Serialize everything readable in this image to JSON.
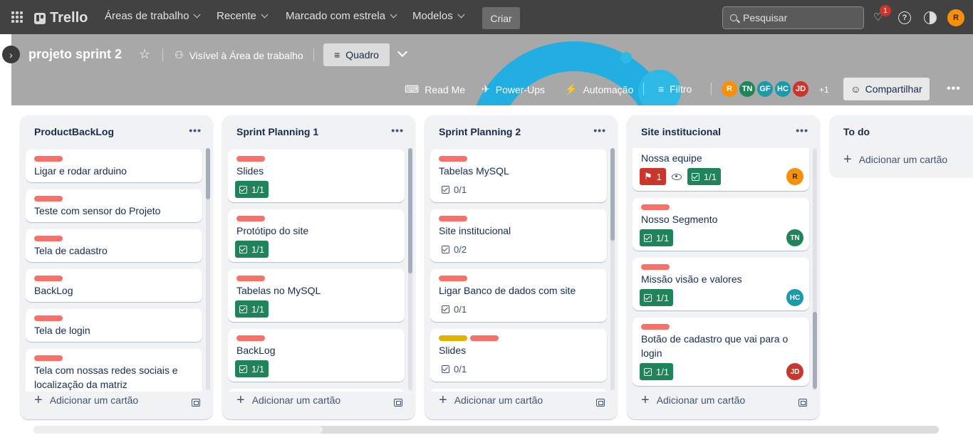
{
  "nav": {
    "brand": "Trello",
    "menus": [
      "Áreas de trabalho",
      "Recente",
      "Marcado com estrela",
      "Modelos"
    ],
    "create_label": "Criar",
    "search_placeholder": "Pesquisar",
    "notification_count": "1",
    "help_glyph": "?",
    "user_initial": "R"
  },
  "board": {
    "title": "projeto sprint 2",
    "visibility": "Visível à Área de trabalho",
    "view": "Quadro",
    "toolbar": [
      "Read Me",
      "Power-Ups",
      "Automação",
      "Filtro"
    ],
    "members": [
      {
        "initials": "R",
        "color": "#f79009"
      },
      {
        "initials": "TN",
        "color": "#1f845a"
      },
      {
        "initials": "GF",
        "color": "#1d9aaa"
      },
      {
        "initials": "HC",
        "color": "#1d9aaa"
      },
      {
        "initials": "JD",
        "color": "#c9372c"
      }
    ],
    "extra_members": "+1",
    "share": "Compartilhar"
  },
  "colors": {
    "label_red": "#f87168",
    "label_yellow": "#e2b203",
    "checklist_done": "#1f845a"
  },
  "lists": [
    {
      "title": "ProductBackLog",
      "add": "Adicionar um cartão",
      "cards": [
        {
          "title": "Ligar e rodar arduino"
        },
        {
          "title": "Teste com sensor do Projeto"
        },
        {
          "title": "Tela de cadastro"
        },
        {
          "title": "BackLog"
        },
        {
          "title": "Tela de login"
        },
        {
          "title": "Tela com nossas redes sociais e localização da matriz"
        }
      ]
    },
    {
      "title": "Sprint Planning 1",
      "add": "Adicionar um cartão",
      "cards": [
        {
          "title": "Slides",
          "checklist": "1/1"
        },
        {
          "title": "Protótipo do site",
          "checklist": "1/1"
        },
        {
          "title": "Tabelas no MySQL",
          "checklist": "1/1"
        },
        {
          "title": "BackLog",
          "checklist": "1/1"
        }
      ]
    },
    {
      "title": "Sprint Planning 2",
      "add": "Adicionar um cartão",
      "cards": [
        {
          "title": "Tabelas MySQL",
          "checklist": "0/1"
        },
        {
          "title": "Site institucional",
          "checklist": "0/2"
        },
        {
          "title": "Ligar Banco de dados com site",
          "checklist": "0/1"
        },
        {
          "title": "Slides",
          "checklist": "0/1"
        }
      ]
    },
    {
      "title": "Site institucional",
      "add": "Adicionar um cartão",
      "cards": [
        {
          "title": "Nossa equipe",
          "pin_count": "1",
          "checklist": "1/1",
          "member": "R"
        },
        {
          "title": "Nosso Segmento",
          "checklist": "1/1",
          "member": "TN"
        },
        {
          "title": "Missão visão e valores",
          "checklist": "1/1",
          "member": "HC"
        },
        {
          "title": "Botão de cadastro que vai para o login",
          "checklist": "1/1",
          "member": "JD"
        }
      ]
    },
    {
      "title": "To do",
      "add": "Adicionar um cartão"
    }
  ]
}
